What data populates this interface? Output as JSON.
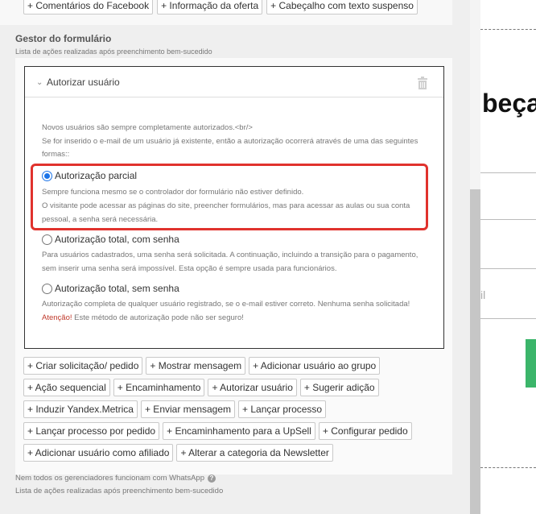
{
  "top_buttons": [
    "+ Comentários do Facebook",
    "+ Informação da oferta",
    "+ Cabeçalho com texto suspenso"
  ],
  "section": {
    "title": "Gestor do formulário",
    "subtitle": "Lista de ações realizadas após preenchimento bem-sucedido"
  },
  "rule": {
    "title": "Autorizar usuário",
    "intro_line1": "Novos usuários são sempre completamente autorizados.<br/>",
    "intro_line2": "Se for inserido o e-mail de um usuário já existente, então a autorização ocorrerá através de uma das seguintes formas::",
    "options": [
      {
        "label": "Autorização parcial",
        "selected": true,
        "desc1": "Sempre funciona mesmo se o controlador dor formulário não estiver definido.",
        "desc2": "O visitante pode acessar as páginas do site, preencher formulários, mas para acessar as aulas ou sua conta pessoal, a senha será necessária."
      },
      {
        "label": "Autorização total, com senha",
        "selected": false,
        "desc1": "Para usuários cadastrados, uma senha será solicitada. A continuação, incluindo a transição para o pagamento, sem inserir uma senha será impossível. Esta opção é sempre usada para funcionários."
      },
      {
        "label": "Autorização total, sem senha",
        "selected": false,
        "desc1": "Autorização completa de qualquer usuário registrado, se o e-mail estiver correto. Nenhuma senha solicitada!",
        "warn": "Atenção!",
        "desc2": "Este método de autorização pode não ser seguro!"
      }
    ]
  },
  "actions": {
    "row1": [
      "+ Criar solicitação/ pedido",
      "+ Mostrar mensagem",
      "+ Adicionar usuário ao grupo"
    ],
    "row2": [
      "+ Ação sequencial",
      "+ Encaminhamento",
      "+ Autorizar usuário",
      "+ Sugerir adição"
    ],
    "row3": [
      "+ Induzir Yandex.Metrica",
      "+ Enviar mensagem",
      "+ Lançar processo"
    ],
    "row4": [
      "+ Lançar processo por pedido",
      "+ Encaminhamento para a UpSell",
      "+ Configurar pedido"
    ],
    "row5": [
      "+ Adicionar usuário como afiliado",
      "+ Alterar a categoria da Newsletter"
    ]
  },
  "footer": {
    "note": "Nem todos os gerenciadores funcionam com WhatsApp",
    "sub": "Lista de ações realizadas após preenchimento bem-sucedido"
  },
  "right_panel": {
    "big_text": "beça",
    "partial_text": "il"
  },
  "colors": {
    "highlight": "#e0322d",
    "radio_selected": "#1a73e8",
    "green_button": "#3bb56a",
    "warning": "#c0392b"
  },
  "icons": [
    "chevron-down-icon",
    "trash-icon",
    "radio-icon",
    "help-icon"
  ]
}
